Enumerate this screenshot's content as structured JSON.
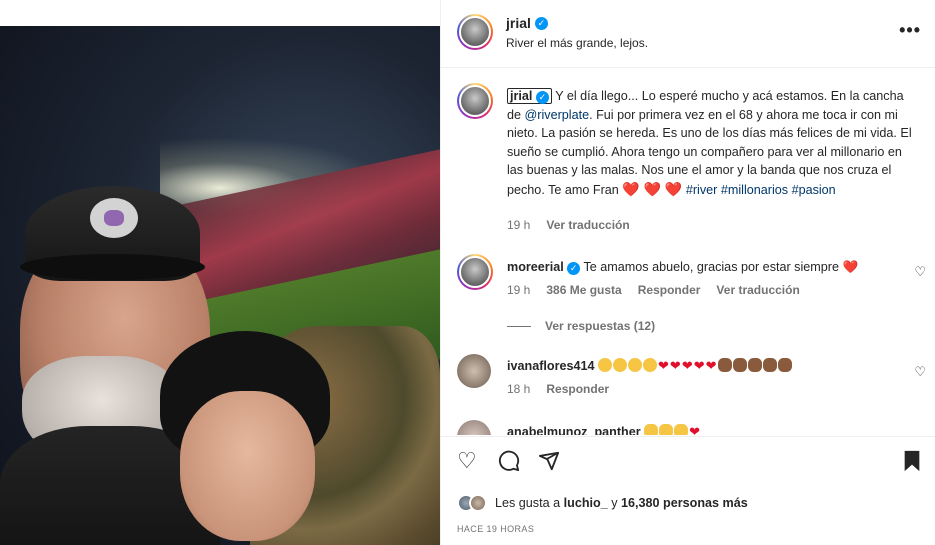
{
  "post": {
    "username": "jrial",
    "location_caption": "River el más grande, lejos.",
    "more_icon": "more-horizontal-icon"
  },
  "caption": {
    "username": "jrial",
    "text_part1": "Y el día llego... Lo esperé mucho y acá estamos. En la cancha de ",
    "mention": "@riverplate",
    "text_part2": ". Fui por primera vez en el 68 y ahora me toca ir con mi nieto. La pasión se hereda. Es uno de los días más felices de mi vida. El sueño se cumplió. Ahora tengo un compañero para ver al millonario en las buenas y las malas. Nos une el amor y la banda que nos cruza el pecho. Te amo Fran ",
    "hearts": "❤️ ❤️ ❤️",
    "hashtags": [
      "#river",
      "#millonarios",
      "#pasion"
    ],
    "time": "19 h",
    "translate": "Ver traducción"
  },
  "comments": [
    {
      "username": "moreerial",
      "verified": true,
      "text": "Te amamos abuelo, gracias por estar siempre ❤️",
      "time": "19 h",
      "likes": "386 Me gusta",
      "reply": "Responder",
      "translate": "Ver traducción",
      "view_replies": "Ver respuestas (12)"
    },
    {
      "username": "ivanaflores414",
      "time": "18 h",
      "reply": "Responder"
    },
    {
      "username": "anabelmunoz_panther"
    }
  ],
  "actions": {
    "like_icon": "heart-outline-icon",
    "comment_icon": "comment-bubble-icon",
    "share_icon": "paper-plane-icon",
    "save_icon": "bookmark-icon"
  },
  "likes": {
    "prefix": "Les gusta a ",
    "user": "luchio_",
    "middle": " y ",
    "count": "16,380 personas más"
  },
  "timestamp": "HACE 19 HORAS"
}
